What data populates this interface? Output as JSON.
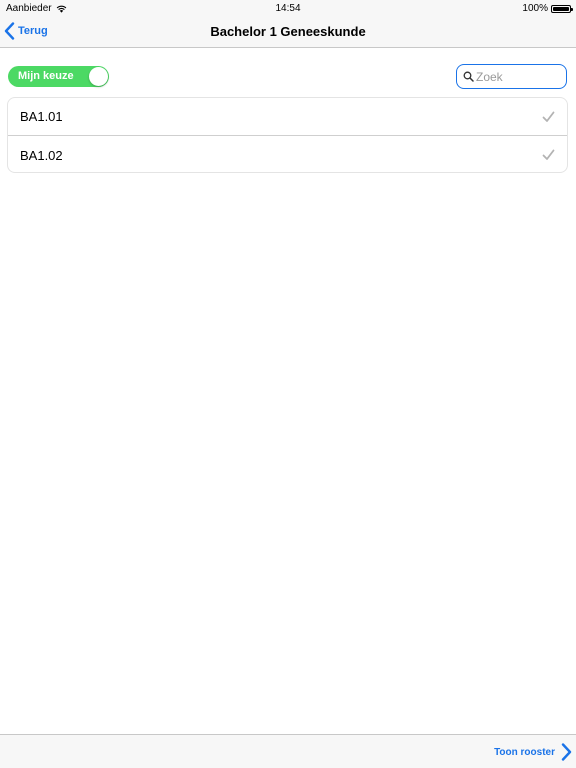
{
  "status_bar": {
    "carrier": "Aanbieder",
    "time": "14:54",
    "battery": "100%"
  },
  "nav": {
    "back_label": "Terug",
    "title": "Bachelor 1 Geneeskunde"
  },
  "filter": {
    "toggle_label": "Mijn keuze",
    "toggle_on": true,
    "search_placeholder": "Zoek",
    "search_value": ""
  },
  "list": {
    "items": [
      {
        "label": "BA1.01",
        "checked": true
      },
      {
        "label": "BA1.02",
        "checked": true
      }
    ]
  },
  "toolbar": {
    "show_schedule_label": "Toon rooster"
  },
  "colors": {
    "accent": "#1a73e8",
    "toggle_on": "#4cd964",
    "check": "#b3b3b3"
  },
  "icons": {
    "wifi": "wifi-icon",
    "battery": "battery-icon",
    "back": "chevron-left-icon",
    "search": "search-icon",
    "check": "checkmark-icon",
    "forward": "chevron-right-icon"
  }
}
